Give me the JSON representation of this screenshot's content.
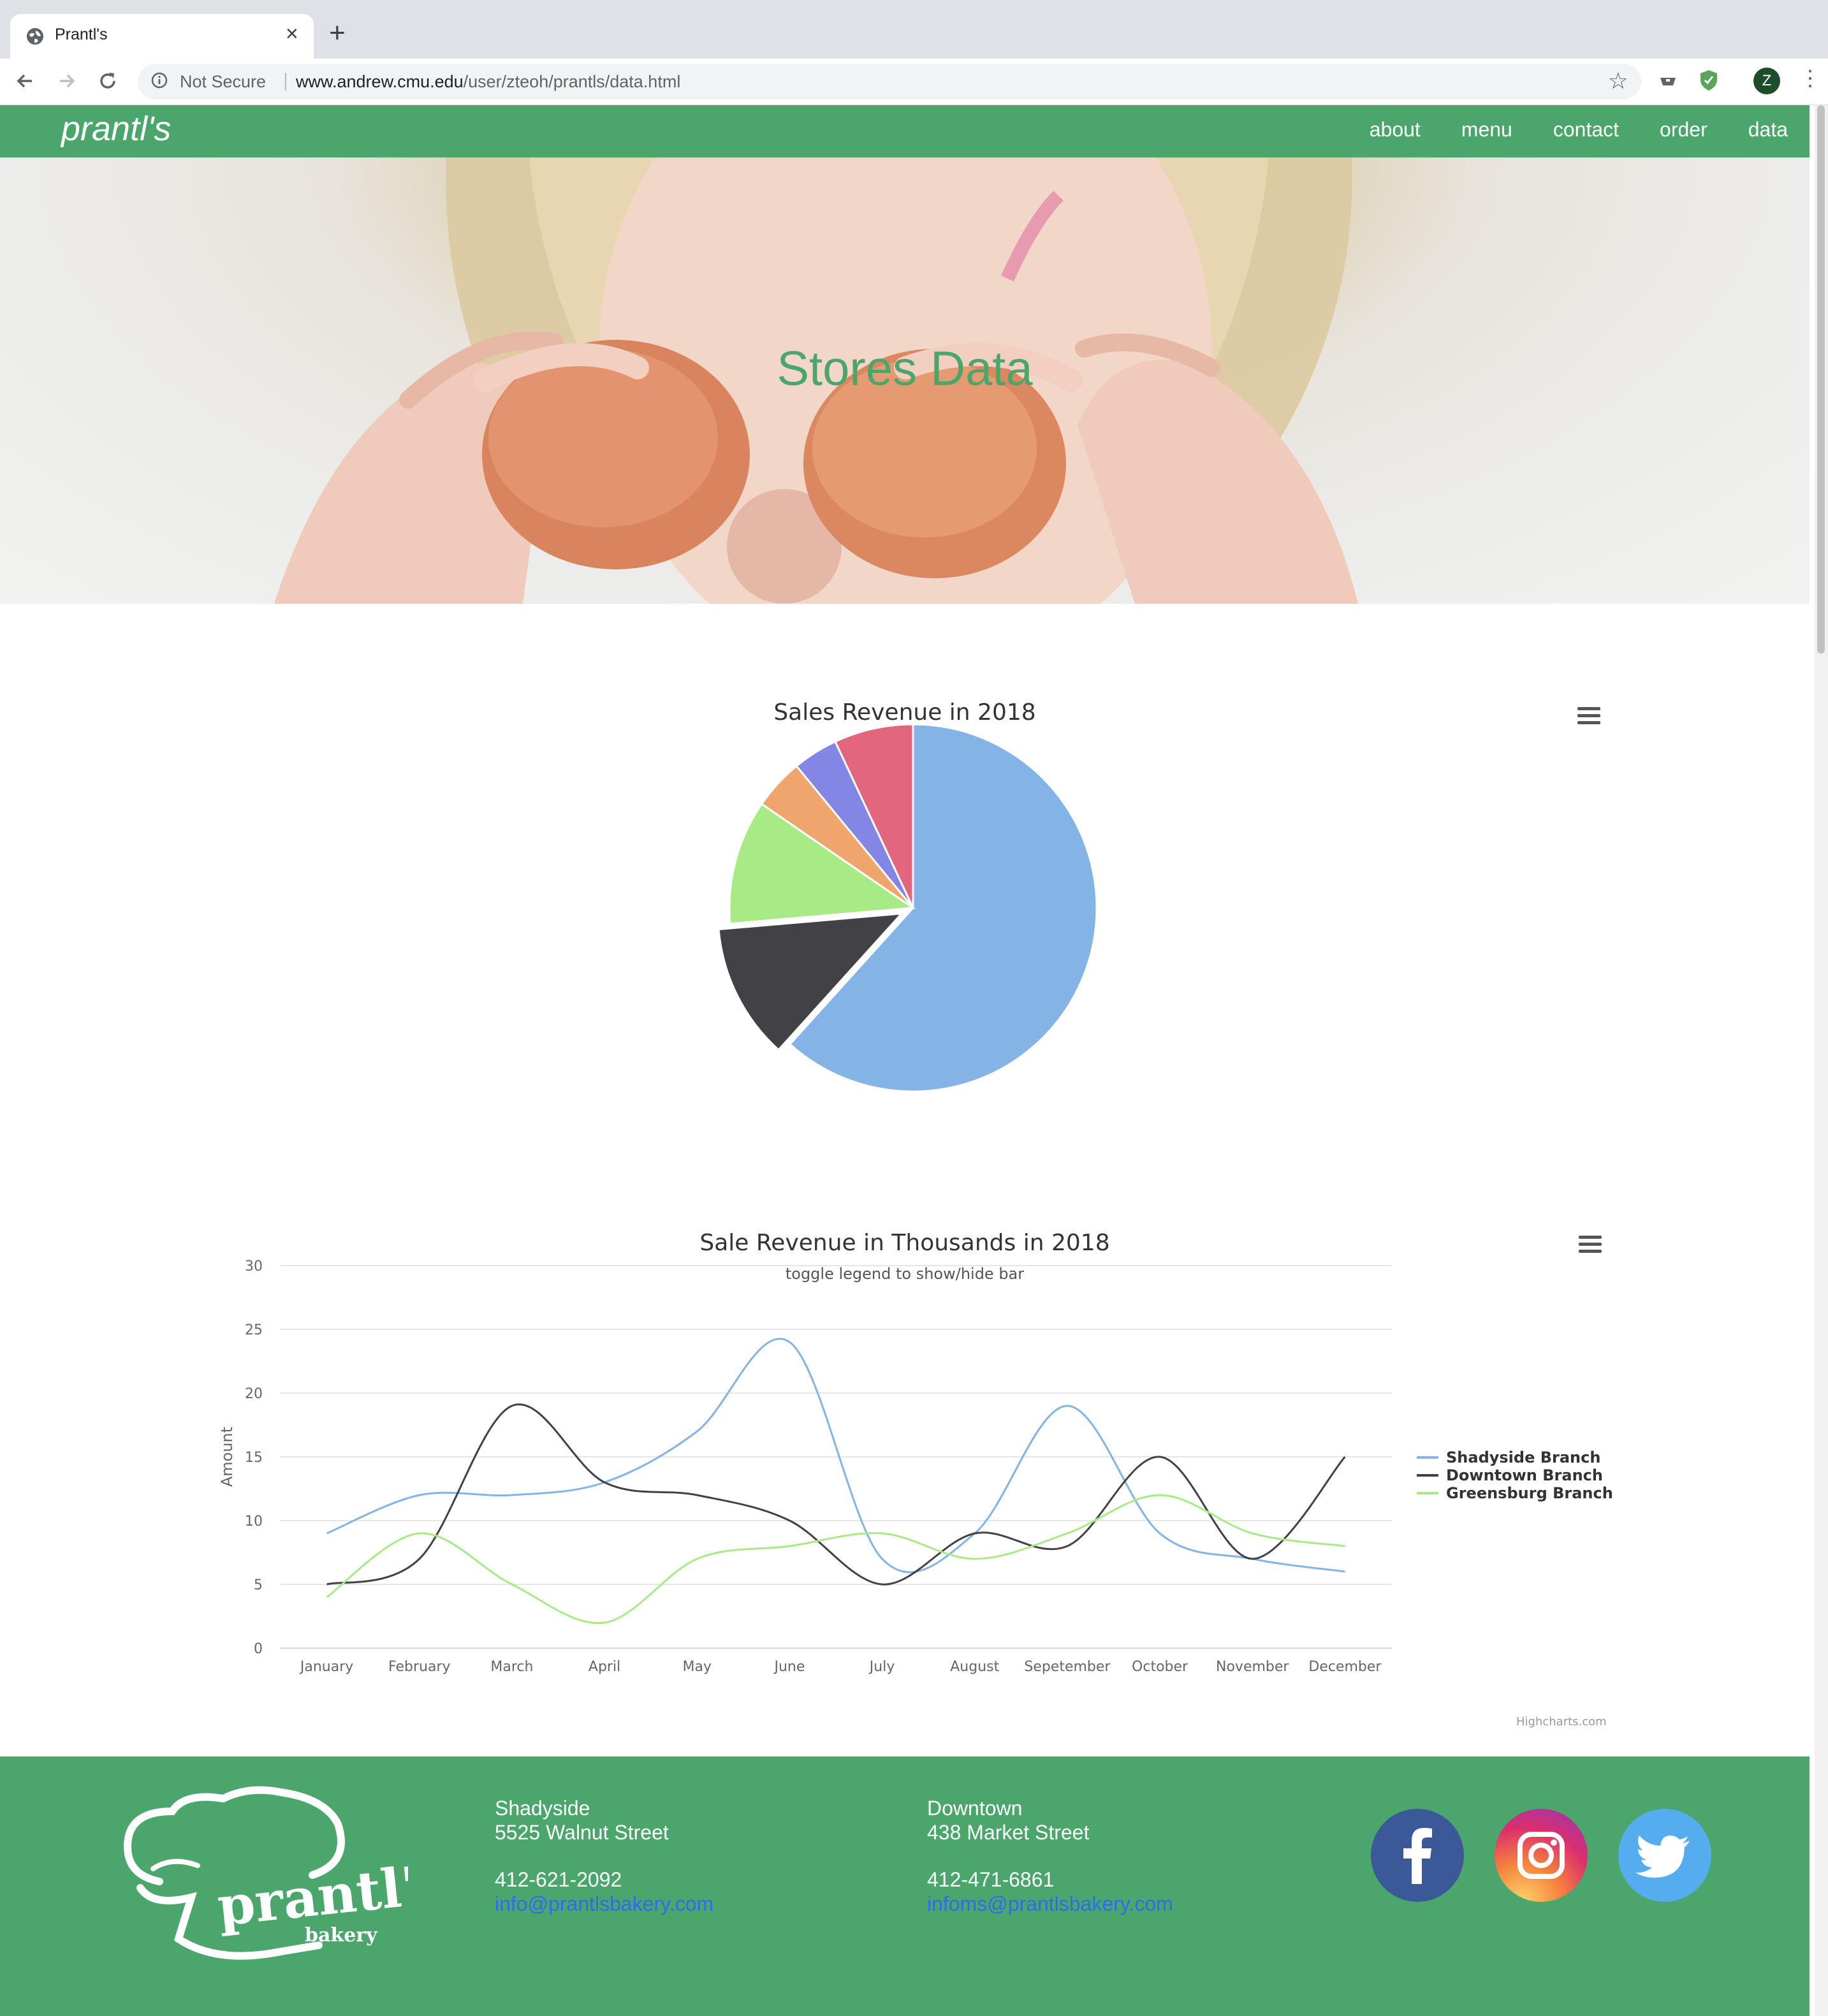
{
  "browser": {
    "tab_title": "Prantl's",
    "security_label": "Not Secure",
    "url_host": "www.andrew.cmu.edu",
    "url_path": "/user/zteoh/prantls/data.html",
    "profile_initial": "Z"
  },
  "site": {
    "brand": "prantl's",
    "nav": [
      "about",
      "menu",
      "contact",
      "order",
      "data"
    ],
    "hero_title": "Stores Data"
  },
  "chart_data": [
    {
      "type": "pie",
      "title": "Sales Revenue in 2018",
      "slices": [
        {
          "value": 62.0,
          "color": "#84b3e6"
        },
        {
          "value": 12.0,
          "color": "#414146",
          "sliced": true
        },
        {
          "value": 11.0,
          "color": "#a7ea86"
        },
        {
          "value": 4.5,
          "color": "#efa56b"
        },
        {
          "value": 4.0,
          "color": "#8486e5"
        },
        {
          "value": 7.0,
          "color": "#e3667f"
        }
      ]
    },
    {
      "type": "line",
      "title": "Sale Revenue in Thousands in 2018",
      "subtitle": "toggle legend to show/hide bar",
      "ylabel": "Amount",
      "xlabel": "",
      "ylim": [
        0,
        30
      ],
      "yticks": [
        "0",
        "5",
        "10",
        "15",
        "20",
        "25",
        "30"
      ],
      "categories": [
        "January",
        "February",
        "March",
        "April",
        "May",
        "June",
        "July",
        "August",
        "Sepetember",
        "October",
        "November",
        "December"
      ],
      "legend_position": "right",
      "series": [
        {
          "name": "Shadyside Branch",
          "color": "#84b3e6",
          "values": [
            9,
            12,
            12,
            13,
            17,
            24,
            7,
            9,
            19,
            9,
            7,
            6
          ]
        },
        {
          "name": "Downtown Branch",
          "color": "#414146",
          "values": [
            5,
            7,
            19,
            13,
            12,
            10,
            5,
            9,
            8,
            15,
            7,
            15
          ]
        },
        {
          "name": "Greensburg Branch",
          "color": "#a7ea86",
          "values": [
            4,
            9,
            5,
            2,
            7,
            8,
            9,
            7,
            9,
            12,
            9,
            8
          ]
        }
      ],
      "credits": "Highcharts.com"
    }
  ],
  "footer": {
    "locations": [
      {
        "name": "Shadyside",
        "street": "5525 Walnut Street",
        "phone": "412-621-2092",
        "email": "info@prantlsbakery.com"
      },
      {
        "name": "Downtown",
        "street": "438 Market Street",
        "phone": "412-471-6861",
        "email": "infoms@prantlsbakery.com"
      }
    ],
    "logo_text": "prantl's",
    "logo_subtext": "bakery",
    "social": [
      "facebook-icon",
      "instagram-icon",
      "twitter-icon"
    ]
  }
}
